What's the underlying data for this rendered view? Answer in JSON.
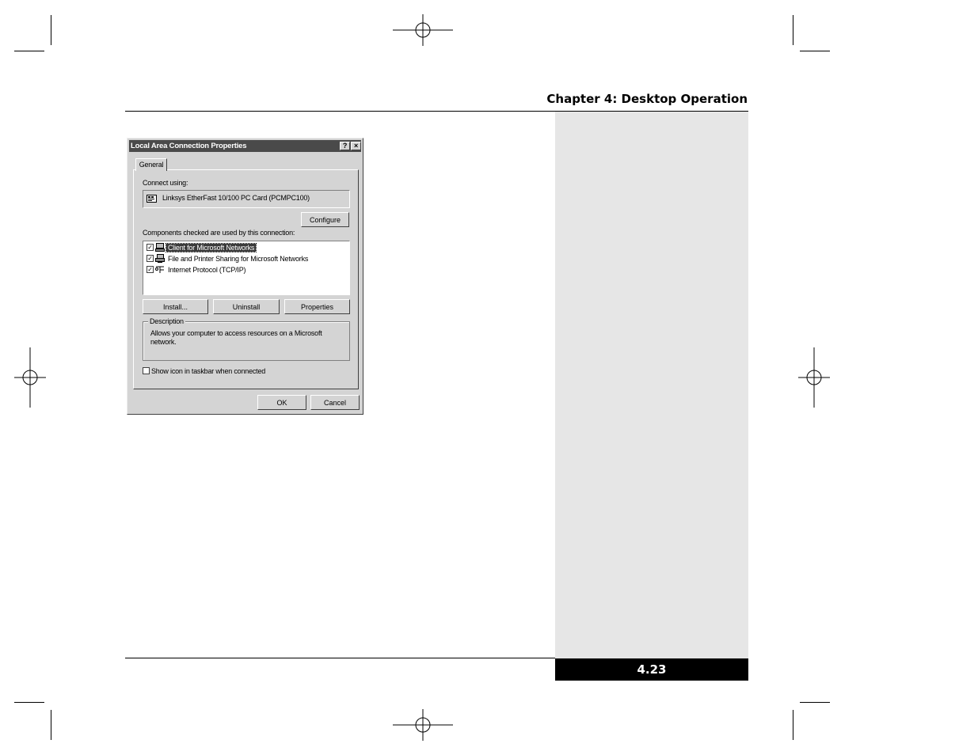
{
  "page": {
    "chapter_title": "Chapter 4: Desktop Operation",
    "page_number": "4.23"
  },
  "dialog": {
    "title": "Local Area Connection Properties",
    "help_glyph": "?",
    "close_glyph": "×",
    "tab_general": "General",
    "connect_using_label": "Connect using:",
    "adapter_name": "Linksys EtherFast 10/100 PC Card (PCMPC100)",
    "configure_button": "Configure",
    "components_label": "Components checked are used by this connection:",
    "components": [
      {
        "label": "Client for Microsoft Networks",
        "checked": true,
        "selected": true,
        "icon": "network-client-icon"
      },
      {
        "label": "File and Printer Sharing for Microsoft Networks",
        "checked": true,
        "selected": false,
        "icon": "file-printer-sharing-icon"
      },
      {
        "label": "Internet Protocol (TCP/IP)",
        "checked": true,
        "selected": false,
        "icon": "protocol-icon"
      }
    ],
    "install_button": "Install...",
    "uninstall_button": "Uninstall",
    "properties_button": "Properties",
    "description_legend": "Description",
    "description_text": "Allows your computer to access resources on a Microsoft network.",
    "show_icon_label": "Show icon in taskbar when connected",
    "show_icon_checked": false,
    "ok_button": "OK",
    "cancel_button": "Cancel",
    "check_glyph": "✓"
  }
}
